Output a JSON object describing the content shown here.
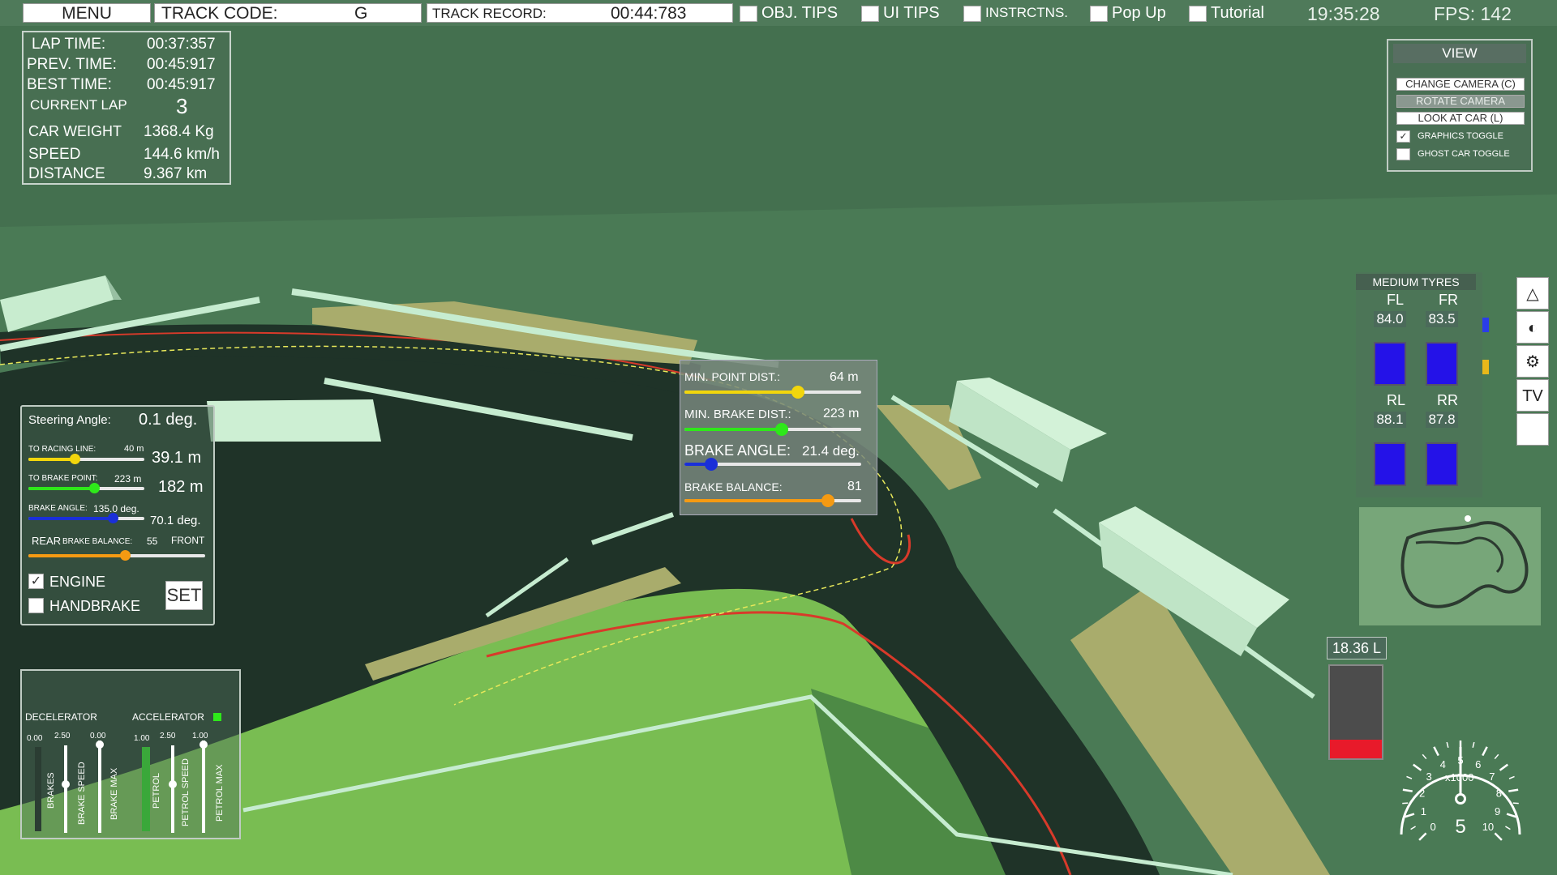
{
  "topbar": {
    "menu_label": "MENU",
    "track_code_label": "TRACK CODE:",
    "track_code_value": "G",
    "track_record_label": "TRACK RECORD:",
    "track_record_value": "00:44:783",
    "toggles": [
      {
        "label": "OBJ. TIPS",
        "checked": false
      },
      {
        "label": "UI  TIPS",
        "checked": false
      },
      {
        "label": "INSTRCTNS.",
        "checked": false
      },
      {
        "label": "Pop Up",
        "checked": false
      },
      {
        "label": "Tutorial",
        "checked": false
      }
    ],
    "clock": "19:35:28",
    "fps": "FPS: 142"
  },
  "stats": {
    "lap_time_label": "LAP TIME:",
    "lap_time": "00:37:357",
    "prev_time_label": "PREV. TIME:",
    "prev_time": "00:45:917",
    "best_time_label": "BEST TIME:",
    "best_time": "00:45:917",
    "current_lap_label": "CURRENT LAP",
    "current_lap": "3",
    "car_weight_label": "CAR WEIGHT",
    "car_weight": "1368.4 Kg",
    "speed_label": "SPEED",
    "speed": "144.6 km/h",
    "distance_label": "DISTANCE",
    "distance": "9.367 km"
  },
  "steering": {
    "steering_angle_label": "Steering Angle:",
    "steering_angle": "0.1 deg.",
    "to_racing_line_label": "TO RACING LINE:",
    "to_racing_line_setting": "40 m",
    "to_racing_line_value": "39.1 m",
    "to_racing_line_level": 0.4,
    "to_brake_point_label": "TO BRAKE POINT:",
    "to_brake_point_setting": "223 m",
    "to_brake_point_value": "182 m",
    "to_brake_point_level": 0.57,
    "brake_angle_label": "BRAKE ANGLE:",
    "brake_angle_setting": "135.0 deg.",
    "brake_angle_value": "70.1 deg.",
    "brake_angle_level": 0.73,
    "rear_label": "REAR",
    "brake_balance_label": "BRAKE BALANCE:",
    "brake_balance_value": "55",
    "front_label": "FRONT",
    "brake_balance_level": 0.55,
    "engine_label": "ENGINE",
    "engine_checked": true,
    "handbrake_label": "HANDBRAKE",
    "handbrake_checked": false,
    "set_label": "SET"
  },
  "brake_popup": {
    "min_point_dist_label": "MIN. POINT DIST.:",
    "min_point_dist_value": "64 m",
    "min_point_dist_level": 0.64,
    "min_brake_dist_label": "MIN. BRAKE DIST.:",
    "min_brake_dist_value": "223 m",
    "min_brake_dist_level": 0.55,
    "brake_angle_label": "BRAKE ANGLE:",
    "brake_angle_value": "21.4 deg.",
    "brake_angle_level": 0.15,
    "brake_balance_label": "BRAKE BALANCE:",
    "brake_balance_value": "81",
    "brake_balance_level": 0.81,
    "colors": {
      "point": "#f2d60c",
      "brake": "#2ee81a",
      "angle": "#1a2fd8",
      "balance": "#f59a12"
    }
  },
  "view": {
    "title": "VIEW",
    "change_camera": "CHANGE CAMERA (C)",
    "rotate_camera": "ROTATE CAMERA",
    "look_at_car": "LOOK AT CAR (L)",
    "graphics_toggle": "GRAPHICS TOGGLE",
    "graphics_checked": true,
    "ghost_car_toggle": "GHOST CAR TOGGLE",
    "ghost_checked": false
  },
  "tyres": {
    "title": "MEDIUM TYRES",
    "fl_label": "FL",
    "fl": "84.0",
    "fr_label": "FR",
    "fr": "83.5",
    "rl_label": "RL",
    "rl": "88.1",
    "rr_label": "RR",
    "rr": "87.8"
  },
  "side_icons": [
    "cone-icon",
    "helmet-icon",
    "engine-icon",
    "tv-icon",
    "blank-icon"
  ],
  "side_icon_tv_label": "TV",
  "pedals": {
    "decelerator_label": "DECELERATOR",
    "accelerator_label": "ACCELERATOR",
    "brakes_value": "0.00",
    "brake_speed_value": "2.50",
    "brake_max_value": "0.00",
    "petrol_value": "1.00",
    "petrol_speed_value": "2.50",
    "petrol_max_value": "1.00",
    "brakes_label": "BRAKES",
    "brake_speed_label": "BRAKE SPEED",
    "brake_max_label": "BRAKE MAX",
    "petrol_label": "PETROL",
    "petrol_speed_label": "PETROL SPEED",
    "petrol_max_label": "PETROL MAX"
  },
  "fuel": {
    "value": "18.36 L",
    "level": 0.2
  },
  "rpm": {
    "unit": "x1000",
    "ticks": [
      "0",
      "1",
      "2",
      "3",
      "4",
      "5",
      "6",
      "7",
      "8",
      "9",
      "10"
    ],
    "gear": "5",
    "value": 5.0
  }
}
